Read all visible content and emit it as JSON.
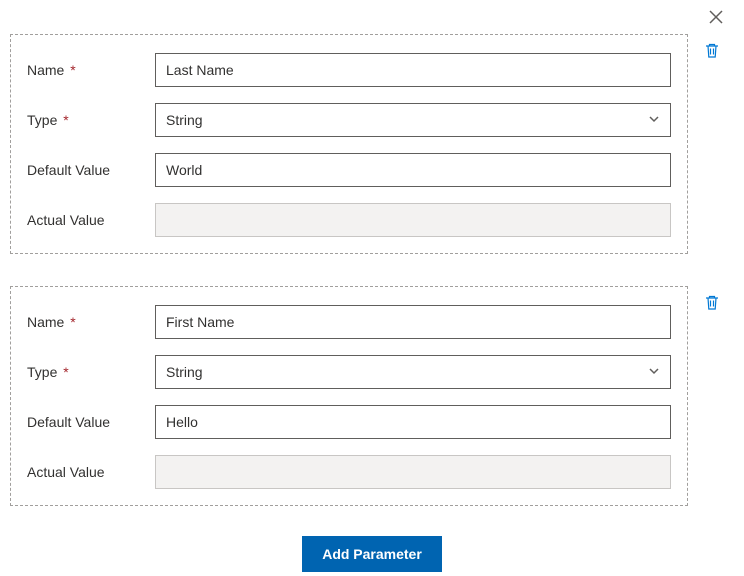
{
  "labels": {
    "name": "Name",
    "type": "Type",
    "default_value": "Default Value",
    "actual_value": "Actual Value",
    "required_marker": "*"
  },
  "parameters": [
    {
      "name": "Last Name",
      "type": "String",
      "default_value": "World",
      "actual_value": ""
    },
    {
      "name": "First Name",
      "type": "String",
      "default_value": "Hello",
      "actual_value": ""
    }
  ],
  "buttons": {
    "add_parameter": "Add Parameter"
  }
}
